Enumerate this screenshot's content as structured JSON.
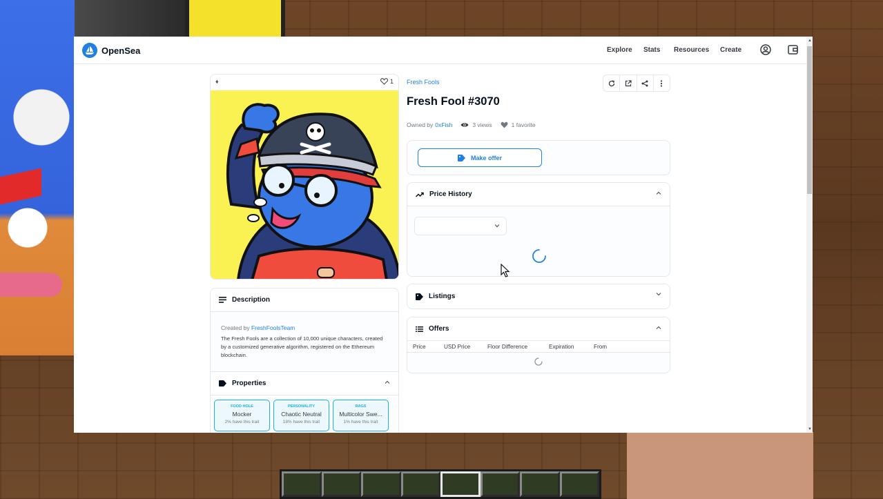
{
  "navbar": {
    "brand": "OpenSea",
    "links": [
      "Explore",
      "Stats",
      "Resources",
      "Create"
    ]
  },
  "image_card": {
    "favorite_count": "1"
  },
  "description": {
    "title": "Description",
    "created_by_label": "Created by",
    "creator": "FreshFoolsTeam",
    "text": "The Fresh Fools are a collection of 10,000 unique characters, created by a customized generative algorithm, registered on the Ethereum blockchain."
  },
  "properties": {
    "title": "Properties",
    "items": [
      {
        "type": "FOOD HOLE",
        "value": "Mocker",
        "rarity": "2% have this trait"
      },
      {
        "type": "PERSONALITY",
        "value": "Chaotic Neutral",
        "rarity": "18% have this trait"
      },
      {
        "type": "RAGS",
        "value": "Multicolor Swe...",
        "rarity": "1% have this trait"
      }
    ]
  },
  "item": {
    "collection": "Fresh Fools",
    "title": "Fresh Fool #3070",
    "owned_by_label": "Owned by",
    "owner": "0xFish",
    "views": "3 views",
    "favorites": "1 favorite"
  },
  "make_offer": {
    "label": "Make offer"
  },
  "price_history": {
    "title": "Price History",
    "period_value": ""
  },
  "listings": {
    "title": "Listings"
  },
  "offers": {
    "title": "Offers",
    "columns": [
      "Price",
      "USD Price",
      "Floor Difference",
      "Expiration",
      "From"
    ]
  },
  "colors": {
    "accent": "#2081e2",
    "trait": "#15b2e5",
    "nft_background": "#faf153",
    "text_primary": "#04111d"
  }
}
